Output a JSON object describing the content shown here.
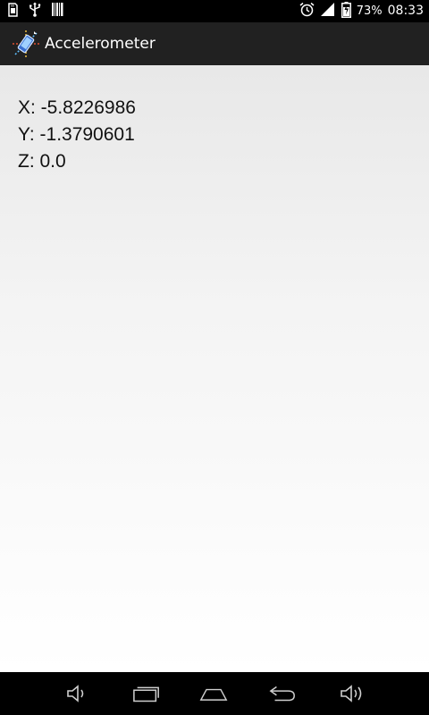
{
  "status_bar": {
    "battery_percent": "73%",
    "time": "08:33",
    "icons_left": [
      "sd-card-icon",
      "usb-icon",
      "barcode-icon"
    ],
    "icons_right": [
      "alarm-icon",
      "signal-icon",
      "battery-icon"
    ]
  },
  "action_bar": {
    "title": "Accelerometer",
    "app_icon": "accelerometer-app-icon"
  },
  "readings": {
    "x": "X: -5.8226986",
    "y": "Y: -1.3790601",
    "z": "Z: 0.0"
  },
  "nav_bar": {
    "buttons": [
      "volume-down-icon",
      "recent-apps-icon",
      "home-icon",
      "back-icon",
      "volume-up-icon"
    ]
  },
  "colors": {
    "status_bar_bg": "#000000",
    "action_bar_bg": "#212121",
    "content_text": "#111111"
  }
}
